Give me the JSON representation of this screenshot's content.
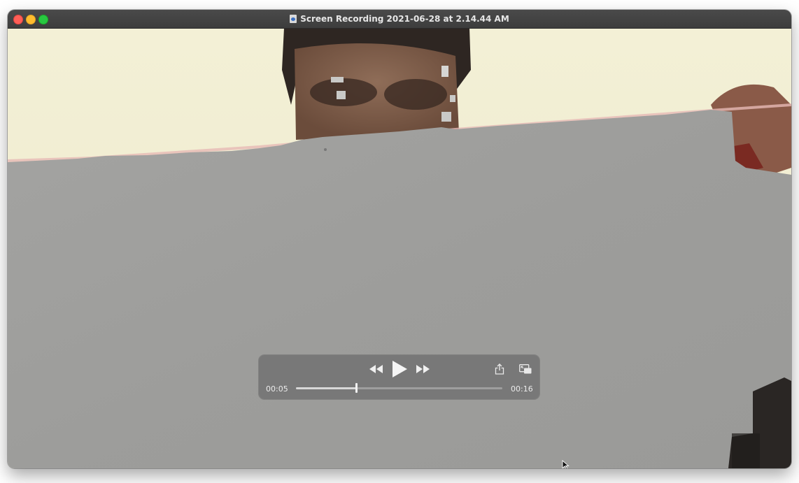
{
  "window": {
    "title": "Screen Recording 2021-06-28 at 2.14.44 AM"
  },
  "icons": {
    "document": "quicktime-document-icon",
    "close": "close-window-icon",
    "minimize": "minimize-window-icon",
    "maximize": "zoom-window-icon",
    "rewind": "rewind-icon",
    "play": "play-icon",
    "fast_forward": "fast-forward-icon",
    "share": "share-icon",
    "pip": "picture-in-picture-icon",
    "cursor": "mouse-pointer-icon"
  },
  "player": {
    "current_time": "00:05",
    "duration": "00:16",
    "progress": 0.29
  },
  "colors": {
    "titlebar": "#3d3d3d",
    "traffic_close": "#ff5f57",
    "traffic_minimize": "#febc2e",
    "traffic_maximize": "#28c840"
  }
}
